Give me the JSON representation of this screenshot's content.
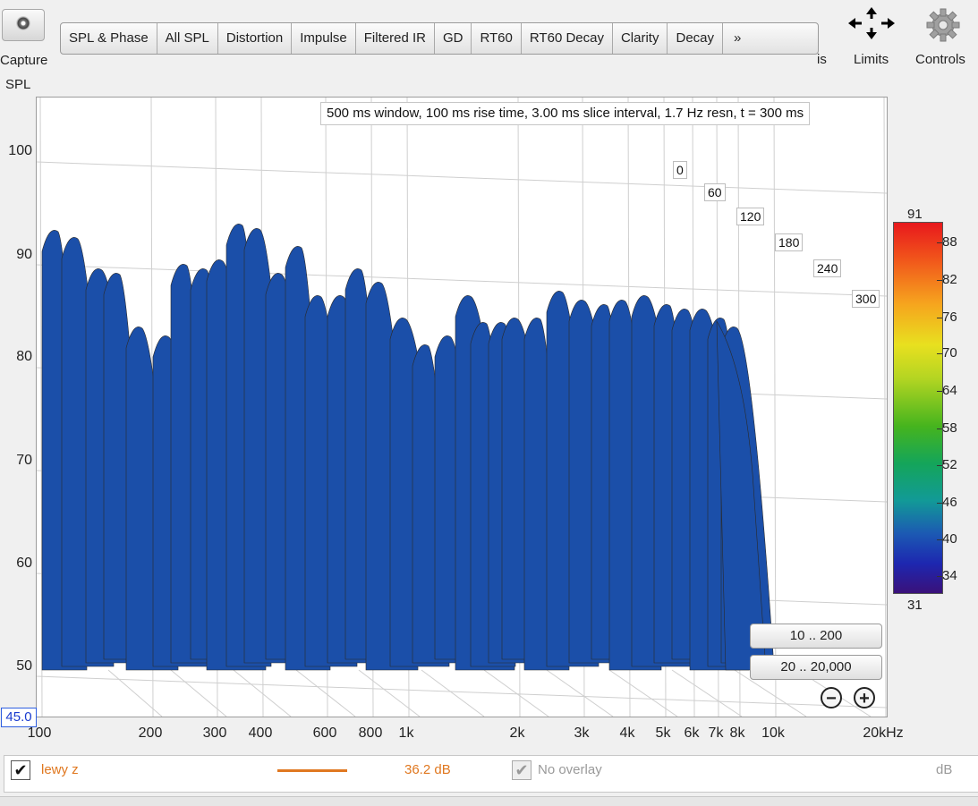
{
  "toolbar": {
    "capture_label": "Capture",
    "tabs": [
      "SPL & Phase",
      "All SPL",
      "Distortion",
      "Impulse",
      "Filtered IR",
      "GD",
      "RT60",
      "RT60 Decay",
      "Clarity",
      "Decay",
      "»"
    ],
    "partial_label": "is",
    "limits_label": "Limits",
    "controls_label": "Controls",
    "limits_icon": "arrows-move-icon",
    "controls_icon": "gear-icon"
  },
  "plot": {
    "y_axis_title": "SPL",
    "y_ticks": [
      "100",
      "90",
      "80",
      "70",
      "60",
      "50"
    ],
    "y_min_box": "45.0",
    "x_ticks": [
      "100",
      "200",
      "300",
      "400",
      "600",
      "800",
      "1k",
      "2k",
      "3k",
      "4k",
      "5k",
      "6k",
      "7k",
      "8k",
      "10k",
      "20kHz"
    ],
    "info": "500 ms window, 100 ms rise time, 3.00 ms slice interval, 1.7 Hz resn, t = 300 ms",
    "time_labels": [
      "0",
      "60",
      "120",
      "180",
      "240",
      "300"
    ],
    "colorbar": {
      "max": "91",
      "min": "31",
      "ticks": [
        "88",
        "82",
        "76",
        "70",
        "64",
        "58",
        "52",
        "46",
        "40",
        "34"
      ]
    },
    "range_buttons": [
      "10 .. 200",
      "20 .. 20,000"
    ]
  },
  "legend": {
    "checked": "✔",
    "name": "lewy z",
    "value": "36.2 dB",
    "overlay_label": "No overlay",
    "unit": "dB",
    "color": "#e07820"
  }
}
